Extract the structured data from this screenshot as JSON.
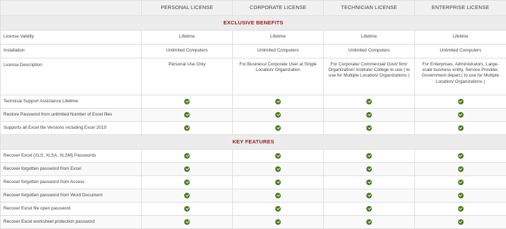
{
  "header": {
    "columns": [
      "PERSONAL LICENSE",
      "CORPORATE LICENSE",
      "TECHNICIAN LICENSE",
      "ENTERPRISE LICENSE"
    ]
  },
  "sections": {
    "exclusive": "EXCLUSIVE BENEFITS",
    "key": "KEY FEATURES"
  },
  "rows": {
    "validity": {
      "label": "License Validity",
      "values": [
        "Lifetime",
        "Lifetime",
        "Lifetime",
        "Lifetime"
      ]
    },
    "installation": {
      "label": "Installation",
      "values": [
        "Unlimited Computers",
        "Unlimited Computers",
        "Unlimited Computers",
        "Unlimited Computers"
      ]
    },
    "description": {
      "label": "License Description",
      "values": [
        "Personal Use Only",
        "For Business/ Corporate User at Single Location/ Organization",
        "For Corporate/ Commercial/ Govt/ firm/ Organization/ Institute/ College to use ( to use for Multiple Location/ Organizations )",
        "For Enterprises, Administrators, Large-scale business entity, Service Provider, Government depart.( to use for Multiple Location/ Organizations )"
      ]
    },
    "support": {
      "label": "Technical Support Assistance Lifetime"
    },
    "restore": {
      "label": "Restore Password from unlimited Number of Excel files"
    },
    "versions": {
      "label": "Supports all Excel file Versions including Excel 2019"
    },
    "recover_xls": {
      "label": "Recover Excel (XLS, XLSA, XLSM) Passwords"
    },
    "from_excel": {
      "label": "Recover forgotten password from Excel"
    },
    "from_access": {
      "label": "Recover forgotten password from Access"
    },
    "from_word": {
      "label": "Recover forgotten password from Word Document"
    },
    "open_pw": {
      "label": "Recover Excel file open password"
    },
    "worksheet_pw": {
      "label": "Recover Excel worksheet protection password"
    }
  },
  "icons": {
    "check": "check-circle-icon",
    "check_color": "#4a7a1c"
  },
  "colors": {
    "section_title": "#9b1c1c",
    "header_bg": "#f1f1f1"
  }
}
